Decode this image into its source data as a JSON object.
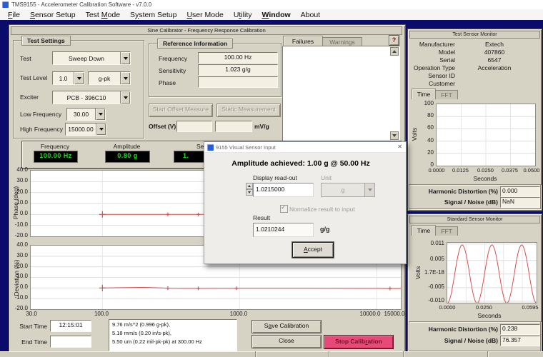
{
  "app": {
    "title": "TMS9155 - Accelerometer Calibration Software - v7.0.0"
  },
  "menu": {
    "items": [
      {
        "pre": "",
        "key": "F",
        "post": "ile"
      },
      {
        "pre": "",
        "key": "S",
        "post": "ensor Setup"
      },
      {
        "pre": "Test ",
        "key": "M",
        "post": "ode"
      },
      {
        "pre": "S",
        "key": "y",
        "post": "stem Setup"
      },
      {
        "pre": "",
        "key": "U",
        "post": "ser Mode"
      },
      {
        "pre": "U",
        "key": "t",
        "post": "ility"
      },
      {
        "pre": "",
        "key": "W",
        "post": "indow"
      },
      {
        "pre": "",
        "key": "",
        "post": "About"
      }
    ]
  },
  "calibrator": {
    "title": "Sine Calibrator - Frequency Response Calibration",
    "test_settings": {
      "group_label": "Test Settings",
      "test_label": "Test",
      "test_value": "Sweep Down",
      "level_label": "Test Level",
      "level_value": "1.0",
      "level_unit": "g-pk",
      "exciter_label": "Exciter",
      "exciter_value": "PCB - 396C10",
      "low_label": "Low Frequency",
      "low_value": "30.00",
      "high_label": "High Frequency",
      "high_value": "15000.00"
    },
    "reference": {
      "group_label": "Reference Information",
      "frequency_label": "Frequency",
      "frequency_value": "100.00 Hz",
      "sensitivity_label": "Sensitivity",
      "sensitivity_value": "1.023 g/g",
      "phase_label": "Phase",
      "phase_value": ""
    },
    "offset": {
      "start_button": "Start Offset Measure",
      "static_button": "Static Measurement",
      "offset_label": "Offset (V)",
      "offset_value": "",
      "sens_value": "",
      "unit": "mV/g"
    },
    "messages": {
      "tabs": [
        "Failures",
        "Warnings"
      ],
      "help_label": "?"
    },
    "displays": [
      {
        "label": "Frequency",
        "value": "100.00 Hz"
      },
      {
        "label": "Amplitude",
        "value": "0.80 g"
      },
      {
        "label": "Se",
        "value": "1."
      }
    ],
    "footer": {
      "start_label": "Start Time",
      "start_value": "12:15:01",
      "end_label": "End Time",
      "end_value": "",
      "info_lines": [
        "9.76 m/s^2 (0.996 g-pk),",
        "5.18 mm/s (0.20 in/s-pk),",
        "5.50 um (0.22 mil-pk-pk) at 300.00 Hz"
      ],
      "save": {
        "pre": "S",
        "key": "a",
        "post": "ve Calibration"
      },
      "close_label": "Close",
      "stop": {
        "pre": "Stop Calib",
        "key": "r",
        "post": "ation"
      }
    }
  },
  "dialog": {
    "title": "9155 Visual Sensor Input",
    "close_glyph": "✕",
    "heading": "Amplitude achieved: 1.00 g @ 50.00 Hz",
    "readout_label": "Display read-out",
    "readout_value": "1.0215000",
    "unit_label": "Unit",
    "unit_value": "g",
    "normalize_label": "Normalize result to input",
    "result_label": "Result",
    "result_value": "1.0210244",
    "result_unit": "g/g",
    "accept": {
      "pre": "",
      "key": "A",
      "post": "ccept"
    }
  },
  "test_monitor": {
    "title": "Test Sensor Monitor",
    "fields": [
      {
        "label": "Manufacturer",
        "value": "Extech"
      },
      {
        "label": "Model",
        "value": "407860"
      },
      {
        "label": "Serial",
        "value": "6547"
      },
      {
        "label": "Operation Type",
        "value": "Acceleration"
      },
      {
        "label": "Sensor ID",
        "value": ""
      },
      {
        "label": "Customer",
        "value": ""
      }
    ],
    "tabs": [
      "Time",
      "FFT"
    ],
    "stats": [
      {
        "label": "Harmonic Distortion (%)",
        "value": "0.000"
      },
      {
        "label": "Signal / Noise (dB)",
        "value": "NaN"
      }
    ]
  },
  "standard_monitor": {
    "title": "Standard Sensor Monitor",
    "tabs": [
      "Time",
      "FFT"
    ],
    "stats": [
      {
        "label": "Harmonic Distortion (%)",
        "value": "0.238"
      },
      {
        "label": "Signal / Noise (dB)",
        "value": "76.357"
      }
    ]
  },
  "colors": {
    "desktop": "#0b0b6b",
    "panel": "#d6d2c4",
    "display_green": "#1de21d",
    "plot_red": "#d94f4f",
    "stop_button": "#e84a78",
    "help_red": "#b50000"
  },
  "chart_data": [
    {
      "id": "phase",
      "type": "line",
      "ylabel": "Phase (deg)",
      "xscale": "log",
      "xlim": [
        30,
        15000
      ],
      "ylim": [
        -20,
        40
      ],
      "yticks": [
        "40.0",
        "30.0",
        "20.0",
        "10.0",
        "0.0",
        "-10.0",
        "-20.0"
      ],
      "xticks": [
        "30.0",
        "100.0",
        "1000.0",
        "10000.0",
        "15000.0"
      ],
      "grid_x": [
        100,
        1000,
        10000
      ],
      "series": [
        {
          "name": "phase",
          "color": "#d94f4f",
          "points": [
            [
              100,
              0
            ],
            [
              300,
              0
            ],
            [
              500,
              0
            ],
            [
              15000,
              0
            ]
          ],
          "markers": [
            100,
            300,
            500
          ]
        }
      ]
    },
    {
      "id": "deviation",
      "type": "line",
      "ylabel": "Deviation (%)",
      "xscale": "log",
      "xlim": [
        30,
        15000
      ],
      "ylim": [
        -20,
        40
      ],
      "yticks": [
        "40.0",
        "30.0",
        "20.0",
        "10.0",
        "0.0",
        "-10.0",
        "-20.0"
      ],
      "xticks": [
        "30.0",
        "100.0",
        "1000.0",
        "10000.0",
        "15000.0"
      ],
      "grid_x": [
        100,
        1000,
        10000
      ],
      "series": [
        {
          "name": "deviation",
          "color": "#d94f4f",
          "points": [
            [
              100,
              0
            ],
            [
              150,
              0.4
            ],
            [
              200,
              0.6
            ],
            [
              250,
              0.2
            ],
            [
              320,
              -0.3
            ],
            [
              500,
              -0.35
            ],
            [
              950,
              -0.3
            ],
            [
              3000,
              -0.3
            ],
            [
              10000,
              -0.35
            ],
            [
              12500,
              -0.5
            ],
            [
              15000,
              -0.55
            ]
          ],
          "markers": [
            100,
            300,
            500,
            950,
            12500
          ]
        }
      ]
    },
    {
      "id": "test_monitor",
      "type": "line",
      "ylabel": "Volts",
      "xlabel": "Seconds",
      "xlim": [
        0,
        0.05
      ],
      "ylim": [
        0,
        100
      ],
      "yticks": [
        "100",
        "80",
        "60",
        "40",
        "20",
        "0"
      ],
      "xticks": [
        "0.0000",
        "0.0125",
        "0.0250",
        "0.0375",
        "0.0500"
      ],
      "series": []
    },
    {
      "id": "standard_monitor",
      "type": "line",
      "ylabel": "Volts",
      "xlabel": "Seconds",
      "xlim": [
        0,
        0.0595
      ],
      "ylim": [
        -0.01055,
        0.0115
      ],
      "yticks": [
        "0.011",
        "0.005",
        "1.7E-18",
        "-0.005",
        "-0.010"
      ],
      "ytick_values": [
        0.011,
        0.005,
        0,
        -0.005,
        -0.01
      ],
      "xticks": [
        "0.0000",
        "0.0250",
        "0.0595"
      ],
      "series": [
        {
          "name": "standard",
          "color": "#d94f4f",
          "wave": {
            "shape": "sine",
            "cycles": 3,
            "amplitude": 0.0107,
            "start": "trough"
          }
        }
      ]
    }
  ]
}
